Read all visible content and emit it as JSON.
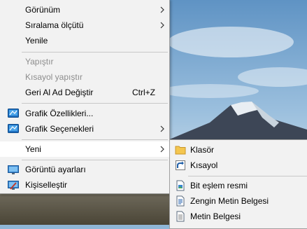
{
  "context_menu": {
    "items": [
      {
        "label": "Görünüm"
      },
      {
        "label": "Sıralama ölçütü"
      },
      {
        "label": "Yenile"
      },
      {
        "label": "Yapıştır"
      },
      {
        "label": "Kısayol yapıştır"
      },
      {
        "label": "Geri Al Ad Değiştir",
        "shortcut": "Ctrl+Z"
      },
      {
        "label": "Grafik Özellikleri..."
      },
      {
        "label": "Grafik Seçenekleri"
      },
      {
        "label": "Yeni"
      },
      {
        "label": "Görüntü ayarları"
      },
      {
        "label": "Kişiselleştir"
      }
    ]
  },
  "new_submenu": {
    "items": [
      {
        "label": "Klasör"
      },
      {
        "label": "Kısayol"
      },
      {
        "label": "Bit eşlem resmi"
      },
      {
        "label": "Zengin Metin Belgesi"
      },
      {
        "label": "Metin Belgesi"
      }
    ]
  }
}
